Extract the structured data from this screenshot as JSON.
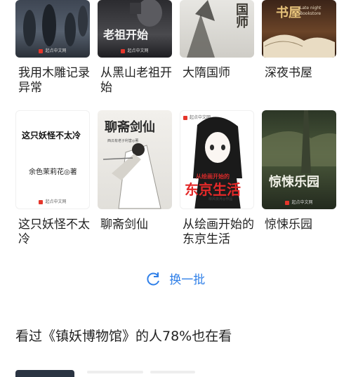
{
  "books_row1": [
    {
      "title": "我用木雕记录异常",
      "publisher": "起点中文网",
      "cover_text": ""
    },
    {
      "title": "从黑山老祖开始",
      "publisher": "起点中文网",
      "cover_text": "老祖开始"
    },
    {
      "title": "大隋国师",
      "publisher": "",
      "cover_text": "国师"
    },
    {
      "title": "深夜书屋",
      "publisher": "",
      "cover_text": "书屋",
      "cover_sub": "Late night Bookstore"
    }
  ],
  "books_row2": [
    {
      "title": "这只妖怪不太冷",
      "publisher": "起点中文网",
      "cover_text": "这只妖怪不太冷",
      "cover_author": "余色茉莉花◎著"
    },
    {
      "title": "聊斋剑仙",
      "publisher": "",
      "cover_text": "聊斋剑仙",
      "cover_author": "西瓜有老子利害◎著"
    },
    {
      "title": "从绘画开始的东京生活",
      "publisher": "起点中文网",
      "cover_text": "东京生活",
      "cover_small": "从绘画开始的",
      "cover_author": "柳风夜月◎作品"
    },
    {
      "title": "惊悚乐园",
      "publisher": "起点中文网",
      "cover_text": "惊悚乐园"
    }
  ],
  "refresh": {
    "label": "换一批"
  },
  "section": {
    "title": "看过《镇妖博物馆》的人78%也在看"
  },
  "colors": {
    "accent": "#2f7fe8",
    "publisher_red": "#e5362b"
  }
}
